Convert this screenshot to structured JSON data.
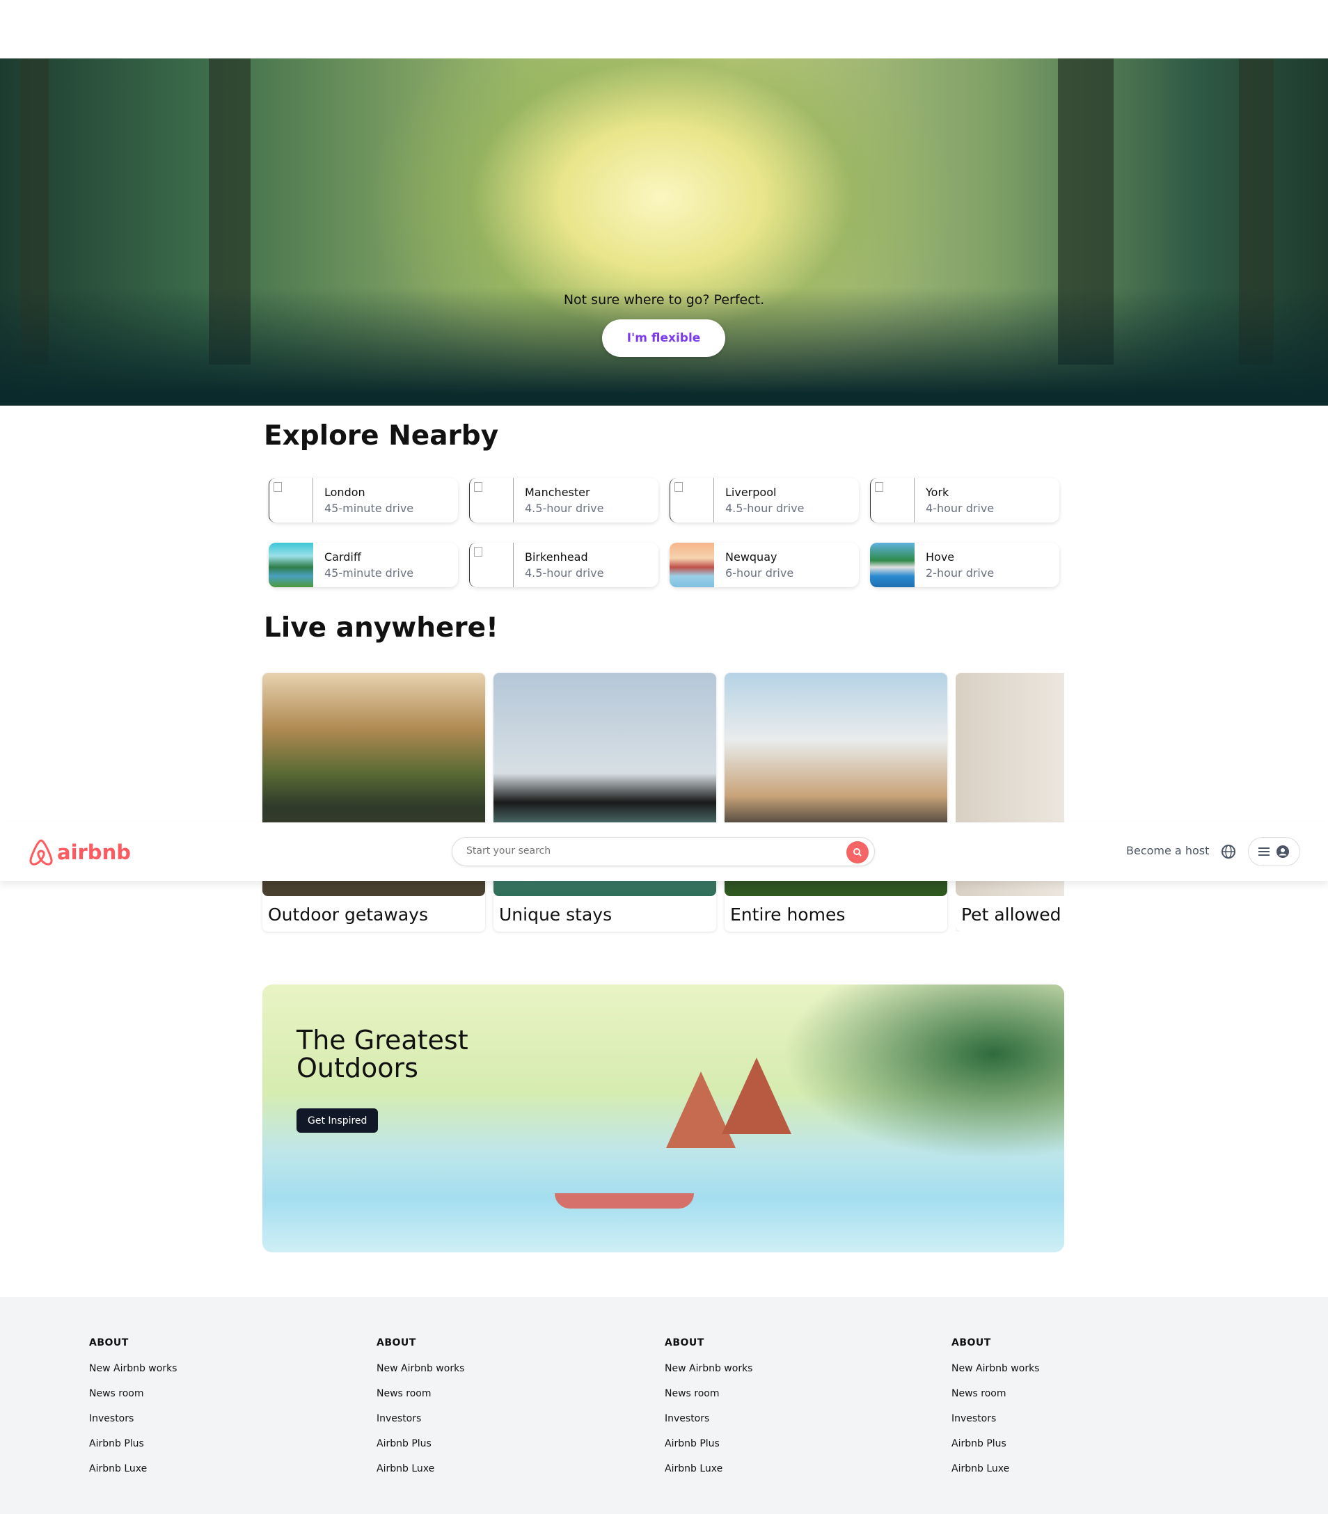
{
  "hero": {
    "tagline": "Not sure where to go? Perfect.",
    "button": "I'm flexible"
  },
  "explore": {
    "title": "Explore Nearby",
    "items": [
      {
        "city": "London",
        "drive": "45-minute drive",
        "image": "broken"
      },
      {
        "city": "Manchester",
        "drive": "4.5-hour drive",
        "image": "broken"
      },
      {
        "city": "Liverpool",
        "drive": "4.5-hour drive",
        "image": "broken"
      },
      {
        "city": "York",
        "drive": "4-hour drive",
        "image": "broken"
      },
      {
        "city": "Cardiff",
        "drive": "45-minute drive",
        "image": "lake"
      },
      {
        "city": "Birkenhead",
        "drive": "4.5-hour drive",
        "image": "broken"
      },
      {
        "city": "Newquay",
        "drive": "6-hour drive",
        "image": "coast"
      },
      {
        "city": "Hove",
        "drive": "2-hour drive",
        "image": "seaside"
      }
    ]
  },
  "live": {
    "title": "Live anywhere!",
    "items": [
      {
        "label": "Outdoor getaways"
      },
      {
        "label": "Unique stays"
      },
      {
        "label": "Entire homes"
      },
      {
        "label": "Pet allowed"
      }
    ]
  },
  "header": {
    "logo": "airbnb",
    "search_placeholder": "Start your search",
    "become_host": "Become a host",
    "brand_color": "#FF5A5F"
  },
  "banner": {
    "title_line1": "The Greatest",
    "title_line2": "Outdoors",
    "button": "Get Inspired"
  },
  "footer": {
    "columns": [
      {
        "heading": "ABOUT",
        "links": [
          "New Airbnb works",
          "News room",
          "Investors",
          "Airbnb Plus",
          "Airbnb Luxe"
        ]
      },
      {
        "heading": "ABOUT",
        "links": [
          "New Airbnb works",
          "News room",
          "Investors",
          "Airbnb Plus",
          "Airbnb Luxe"
        ]
      },
      {
        "heading": "ABOUT",
        "links": [
          "New Airbnb works",
          "News room",
          "Investors",
          "Airbnb Plus",
          "Airbnb Luxe"
        ]
      },
      {
        "heading": "ABOUT",
        "links": [
          "New Airbnb works",
          "News room",
          "Investors",
          "Airbnb Plus",
          "Airbnb Luxe"
        ]
      }
    ]
  }
}
